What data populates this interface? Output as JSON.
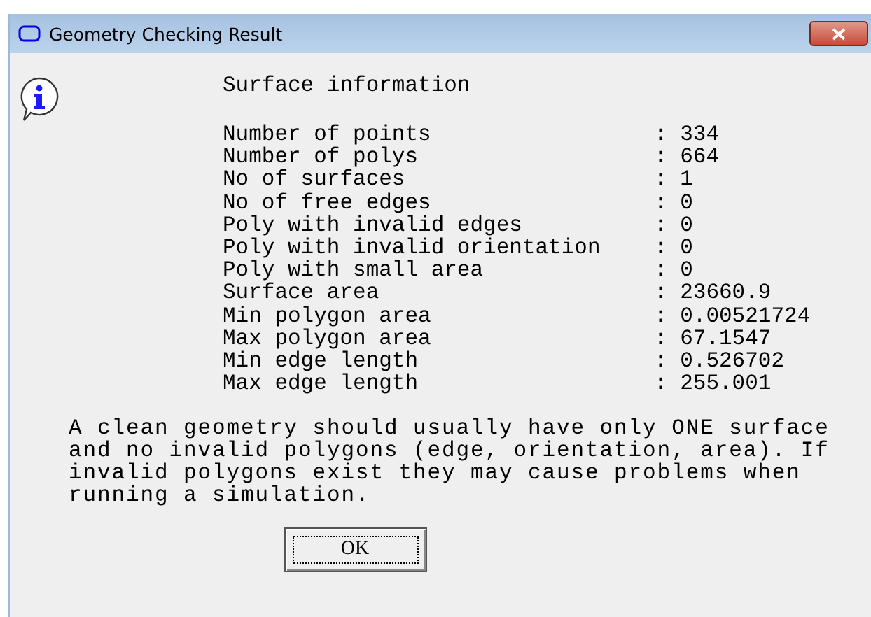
{
  "window": {
    "title": "Geometry Checking Result"
  },
  "heading": "Surface information",
  "rows": [
    {
      "label": "Number of points",
      "value": ": 334"
    },
    {
      "label": "Number of polys",
      "value": ": 664"
    },
    {
      "label": "No of surfaces",
      "value": ": 1"
    },
    {
      "label": "No of free edges",
      "value": ": 0"
    },
    {
      "label": "Poly with invalid edges",
      "value": ": 0"
    },
    {
      "label": "Poly with invalid orientation",
      "value": ": 0"
    },
    {
      "label": "Poly with small area",
      "value": ": 0"
    },
    {
      "label": "Surface area",
      "value": ": 23660.9"
    },
    {
      "label": "Min polygon area",
      "value": ": 0.00521724"
    },
    {
      "label": "Max polygon area",
      "value": ": 67.1547"
    },
    {
      "label": "Min edge length",
      "value": ": 0.526702"
    },
    {
      "label": "Max edge length",
      "value": ": 255.001"
    }
  ],
  "note": "A clean geometry should usually have only ONE surface\nand no invalid polygons (edge, orientation, area). If\ninvalid polygons exist they may cause problems when\nrunning a simulation.",
  "buttons": [
    "OK"
  ]
}
